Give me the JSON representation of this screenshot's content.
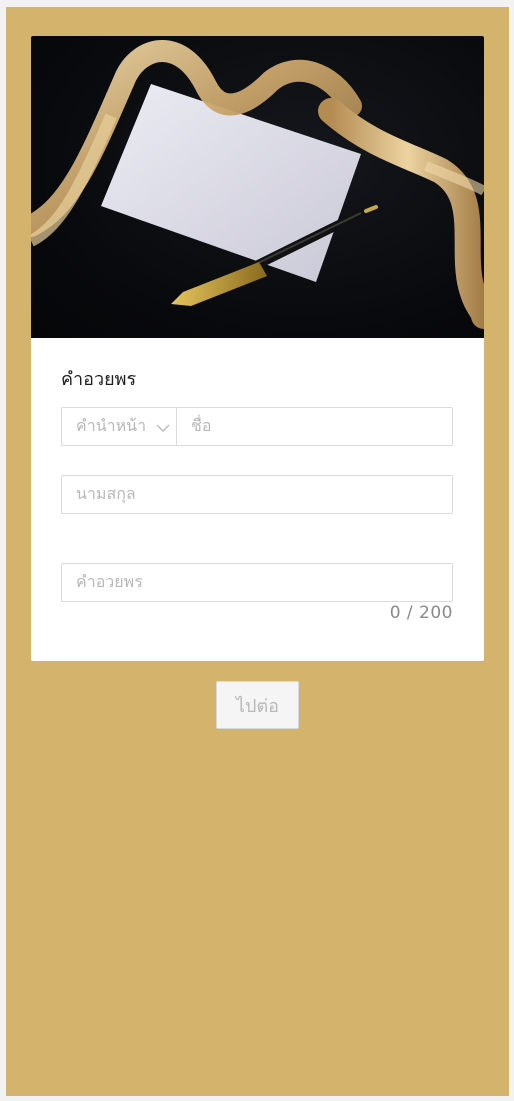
{
  "form": {
    "section_title": "คำอวยพร",
    "prefix_placeholder": "คำนำหน้า",
    "firstname_placeholder": "ชื่อ",
    "lastname_placeholder": "นามสกุล",
    "wish_placeholder": "คำอวยพร",
    "char_count": "0 / 200"
  },
  "actions": {
    "next_label": "ไปต่อ"
  },
  "colors": {
    "page_background": "#d4b36d",
    "card": "#ffffff",
    "placeholder": "#b8b8b8"
  },
  "icons": {
    "prefix_dropdown": "chevron-down-icon"
  }
}
